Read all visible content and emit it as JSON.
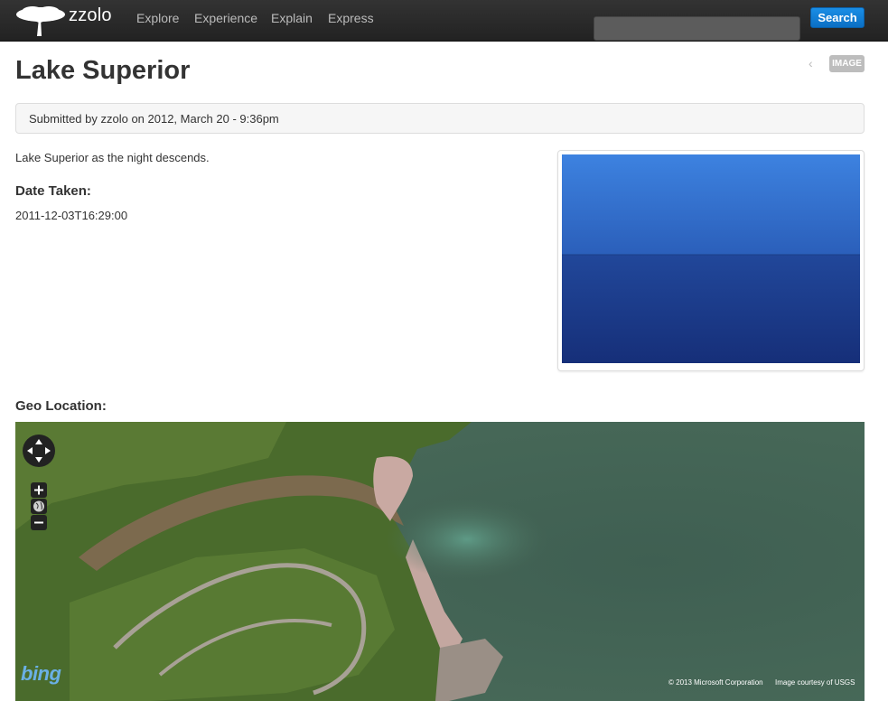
{
  "navbar": {
    "brand": "zzolo",
    "items": [
      {
        "label": "Explore"
      },
      {
        "label": "Experience"
      },
      {
        "label": "Explain"
      },
      {
        "label": "Express"
      }
    ],
    "search_placeholder": "",
    "search_button": "Search"
  },
  "node": {
    "title": "Lake Superior",
    "type_badge": "IMAGE",
    "submitted": "Submitted by zzolo on 2012, March 20 - 9:36pm",
    "body": "Lake Superior as the night descends.",
    "date_taken_label": "Date Taken:",
    "date_taken_value": "2011-12-03T16:29:00",
    "geo_label": "Geo Location:"
  },
  "map": {
    "logo": "bing",
    "copyright": "© 2013 Microsoft Corporation",
    "credit": "Image courtesy of USGS"
  },
  "colors": {
    "navbar_bg": "#222222",
    "accent": "#0b6fc4",
    "badge": "#bdbdbd"
  },
  "icons": {
    "logo": "tree-icon",
    "pager": "chevron-left-icon",
    "map_pan": "pan-arrows-icon",
    "zoom_in": "plus-icon",
    "globe": "globe-icon",
    "zoom_out": "minus-icon"
  }
}
